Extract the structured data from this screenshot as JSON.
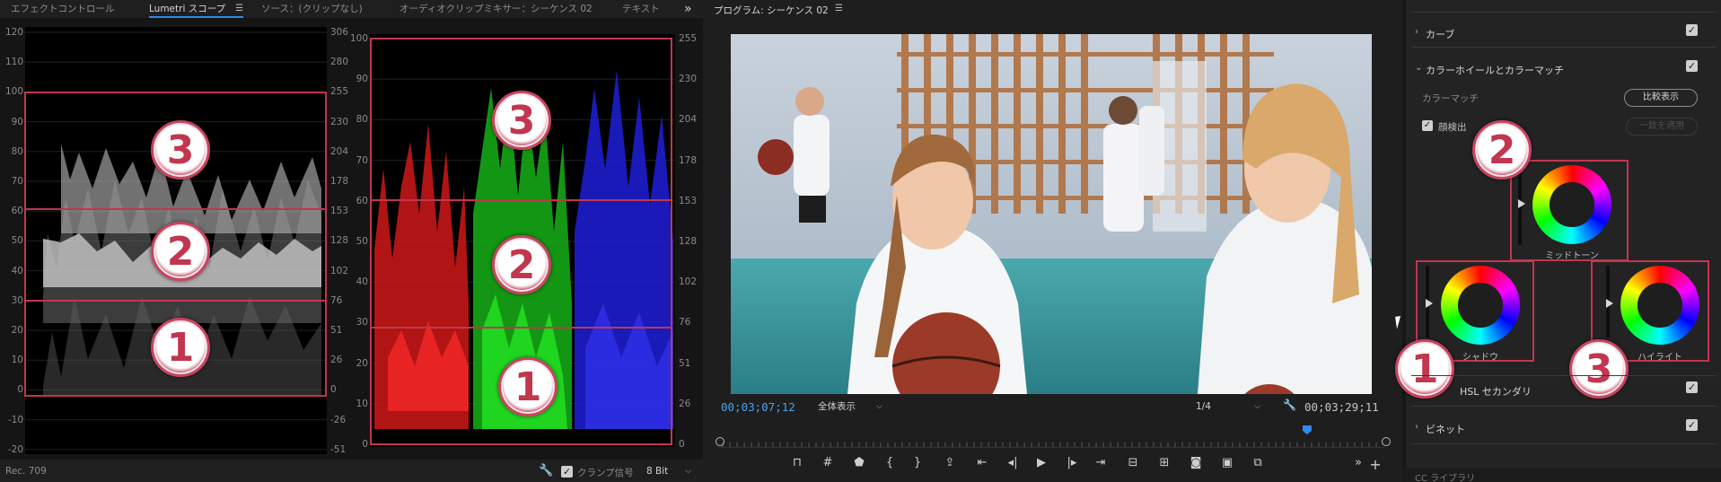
{
  "left_panel": {
    "tabs": [
      {
        "label": "エフェクトコントロール"
      },
      {
        "label": "Lumetri スコープ",
        "active": true
      },
      {
        "label": "ソース：(クリップなし)"
      },
      {
        "label": "オーディオクリップミキサー：シーケンス 02"
      },
      {
        "label": "テキスト"
      }
    ],
    "overflow_glyph": "»",
    "waveform": {
      "left_ticks": [
        "120",
        "110",
        "100",
        "90",
        "80",
        "70",
        "60",
        "50",
        "40",
        "30",
        "20",
        "10",
        "0",
        "-10",
        "-20"
      ],
      "right_ticks": [
        "306",
        "280",
        "255",
        "230",
        "204",
        "178",
        "153",
        "128",
        "102",
        "76",
        "51",
        "26",
        "0",
        "-26",
        "-51"
      ]
    },
    "parade": {
      "left_ticks": [
        "100",
        "90",
        "80",
        "70",
        "60",
        "50",
        "40",
        "30",
        "20",
        "10",
        "0"
      ],
      "right_ticks": [
        "255",
        "230",
        "204",
        "178",
        "153",
        "128",
        "102",
        "76",
        "51",
        "26",
        "0"
      ]
    },
    "badges": {
      "one": "1",
      "two": "2",
      "three": "3"
    },
    "footer": {
      "rec_label": "Rec. 709",
      "clamp_label": "クランプ信号",
      "clamp_checked": "✓",
      "bit_depth": "8 Bit"
    }
  },
  "program_monitor": {
    "title": "プログラム: シーケンス 02",
    "current_timecode": "00;03;07;12",
    "fit_dropdown": "全体表示",
    "resolution_dropdown": "1/4",
    "duration_timecode": "00;03;29;11",
    "playhead_fraction": 0.885
  },
  "lumetri_panel": {
    "sections": {
      "curves": "カーブ",
      "color_wheels": "カラーホイールとカラーマッチ",
      "hsl": "HSL セカンダリ",
      "vignette": "ビネット"
    },
    "color_match_label": "カラーマッチ",
    "compare_button": "比較表示",
    "face_detect_label": "顔検出",
    "apply_match_button": "一致を適用",
    "wheels": {
      "midtone": "ミッドトーン",
      "shadow": "シャドウ",
      "highlight": "ハイライト"
    },
    "badges": {
      "one": "1",
      "two": "2",
      "three": "3"
    },
    "cc_library": "CC ライブラリ",
    "check_glyph": "✓",
    "accent_color": "#2d8ceb",
    "annotation_color": "#c2364f"
  }
}
